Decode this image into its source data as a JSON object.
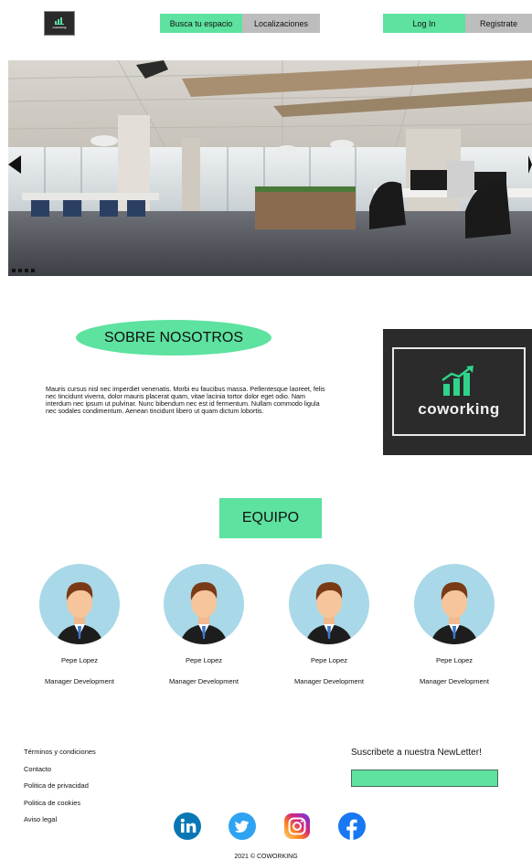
{
  "header": {
    "logo_text": "coworking",
    "nav": [
      "Busca tu espacio",
      "Localizaciones"
    ],
    "auth": {
      "login": "Log In",
      "register": "Registrate"
    }
  },
  "hero": {
    "icons": {
      "prev": "arrow-left-icon",
      "next": "arrow-right-icon"
    },
    "slide_count": 4
  },
  "about": {
    "title": "SOBRE NOSOTROS",
    "body": "Mauris cursus nisl nec imperdiet venenatis. Morbi eu faucibus massa. Pellentesque laoreet, felis nec tincidunt viverra, dolor mauris placerat quam, vitae lacinia tortor dolor eget odio. Nam interdum nec ipsum ut pulvinar. Nunc bibendum nec est id fermentum. Nullam commodo ligula nec sodales condimentum. Aenean tincidunt libero ut quam dictum lobortis.",
    "brand": "coworking"
  },
  "team": {
    "title": "EQUIPO",
    "members": [
      {
        "name": "Pepe Lopez",
        "role": "Manager Development"
      },
      {
        "name": "Pepe Lopez",
        "role": "Manager Development"
      },
      {
        "name": "Pepe Lopez",
        "role": "Manager Development"
      },
      {
        "name": "Pepe Lopez",
        "role": "Manager Development"
      }
    ]
  },
  "footer": {
    "links": [
      "Términos y condiciones",
      "Contacto",
      "Politica de privacidad",
      "Politica de cookies",
      "Aviso legal"
    ],
    "newsletter_title": "Suscribete a nuestra NewLetter!",
    "newsletter_placeholder": "",
    "social_icons": [
      "linkedin-icon",
      "twitter-icon",
      "instagram-icon",
      "facebook-icon"
    ],
    "copyright": "2021 © COWORKING"
  },
  "colors": {
    "accent": "#5de29f",
    "grey_button": "#bdbdbd",
    "dark_card": "#2b2b2b",
    "avatar_bg": "#a9d8e8"
  }
}
